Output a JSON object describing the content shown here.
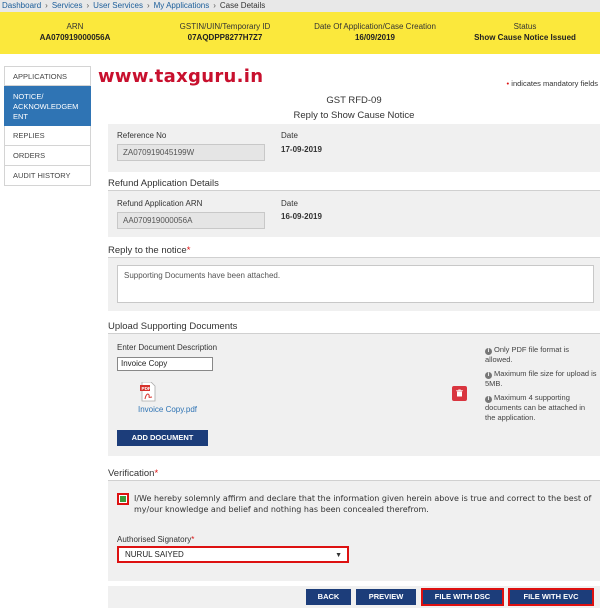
{
  "breadcrumb": {
    "items": [
      "Dashboard",
      "Services",
      "User Services",
      "My Applications"
    ],
    "current": "Case Details"
  },
  "info": {
    "arn_label": "ARN",
    "arn_value": "AA070919000056A",
    "gstin_label": "GSTIN/UIN/Temporary ID",
    "gstin_value": "07AQDPP8277H7Z7",
    "date_label": "Date Of Application/Case Creation",
    "date_value": "16/09/2019",
    "status_label": "Status",
    "status_value": "Show Cause Notice Issued"
  },
  "sidebar": {
    "items": [
      "APPLICATIONS",
      "NOTICE/ ACKNOWLEDGEM ENT",
      "REPLIES",
      "ORDERS",
      "AUDIT HISTORY"
    ]
  },
  "watermark": "www.taxguru.in",
  "mandatory_note": "indicates mandatory fields",
  "form": {
    "title": "GST RFD-09",
    "subtitle": "Reply to Show Cause Notice"
  },
  "reference": {
    "ref_label": "Reference No",
    "ref_value": "ZA070919045199W",
    "date_label": "Date",
    "date_value": "17-09-2019"
  },
  "refund": {
    "heading": "Refund Application Details",
    "arn_label": "Refund Application ARN",
    "arn_value": "AA070919000056A",
    "date_label": "Date",
    "date_value": "16-09-2019"
  },
  "reply": {
    "heading": "Reply to the notice",
    "text": "Supporting Documents have been attached."
  },
  "upload": {
    "heading": "Upload Supporting Documents",
    "desc_label": "Enter Document Description",
    "desc_value": "Invoice Copy",
    "file_name": "Invoice Copy.pdf",
    "add_button": "ADD DOCUMENT",
    "notes": [
      "Only PDF file format is allowed.",
      "Maximum file size for upload is 5MB.",
      "Maximum 4 supporting documents can be attached in the application."
    ]
  },
  "verification": {
    "heading": "Verification",
    "declaration": "I/We hereby solemnly affirm and declare that the information given herein above is true and correct to the best of my/our knowledge and belief and nothing has been concealed therefrom.",
    "signatory_label": "Authorised Signatory",
    "signatory_value": "NURUL SAIYED"
  },
  "actions": {
    "back": "BACK",
    "preview": "PREVIEW",
    "file_dsc": "FILE WITH DSC",
    "file_evc": "FILE WITH EVC"
  },
  "colors": {
    "info_bar": "#fbe83c",
    "primary_button": "#1c3d7a",
    "sidebar_active": "#2f74b4",
    "highlight_red": "#dd1111"
  }
}
